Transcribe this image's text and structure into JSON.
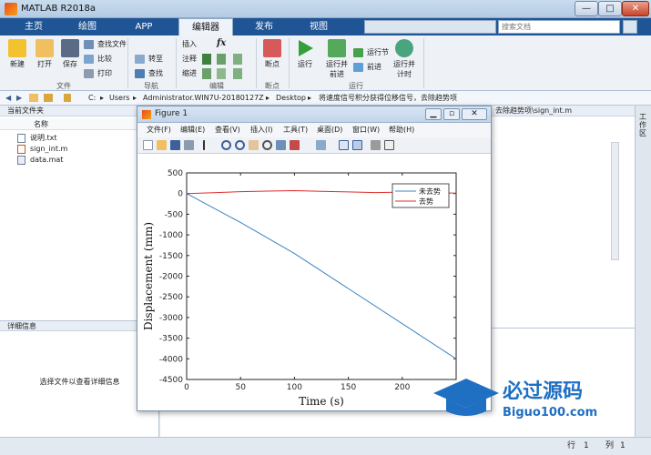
{
  "window": {
    "title": "MATLAB R2018a",
    "min": "—",
    "max": "□",
    "close": "✕"
  },
  "tabs": [
    {
      "label": "主页",
      "active": false
    },
    {
      "label": "绘图",
      "active": false
    },
    {
      "label": "APP",
      "active": false
    },
    {
      "label": "编辑器",
      "active": true
    },
    {
      "label": "发布",
      "active": false
    },
    {
      "label": "视图",
      "active": false
    }
  ],
  "search": {
    "placeholder": "搜索文档"
  },
  "ribbon": {
    "file": {
      "new": "新建",
      "open": "打开",
      "save": "保存",
      "find_files": "查找文件",
      "compare": "比较",
      "print": "打印",
      "group": "文件"
    },
    "nav": {
      "goto": "转至",
      "find": "查找",
      "group": "导航"
    },
    "edit": {
      "insert": "插入",
      "comment": "注释",
      "indent": "缩进",
      "fx": "fx",
      "group": "编辑"
    },
    "breakpoints": {
      "bp": "断点",
      "group": "断点"
    },
    "run": {
      "run": "运行",
      "run_advance": "运行并",
      "run_advance2": "前进",
      "run_section": "运行节",
      "advance": "前进",
      "run_time": "运行并",
      "run_time2": "计时",
      "group": "运行"
    }
  },
  "address": {
    "segments": [
      "C:",
      "Users",
      "Administrator.WIN7U-20180127Z",
      "Desktop",
      "将速度信号积分获得位移信号，去除趋势项"
    ]
  },
  "left_panel": {
    "title": "当前文件夹",
    "col_name": "名称",
    "files": [
      "说明.txt",
      "sign_int.m",
      "data.mat"
    ],
    "details_title": "详细信息",
    "details_text": "选择文件以查看详细信息"
  },
  "editor": {
    "tab_text": "去除趋势项\\sign_int.m"
  },
  "right_strip": {
    "label": "工作区"
  },
  "statusbar": {
    "row_label": "行",
    "row_value": "1",
    "col_label": "列",
    "col_value": "1"
  },
  "figure": {
    "title": "Figure 1",
    "menus": [
      "文件(F)",
      "编辑(E)",
      "查看(V)",
      "插入(I)",
      "工具(T)",
      "桌面(D)",
      "窗口(W)",
      "帮助(H)"
    ]
  },
  "chart_data": {
    "type": "line",
    "xlabel": "Time (s)",
    "ylabel": "Displacement (mm)",
    "xlim": [
      0,
      250
    ],
    "ylim": [
      -4500,
      500
    ],
    "xticks": [
      0,
      50,
      100,
      150,
      200
    ],
    "yticks": [
      500,
      0,
      -500,
      -1000,
      -1500,
      -2000,
      -2500,
      -3000,
      -3500,
      -4000,
      -4500
    ],
    "legend_position": "top-right",
    "series": [
      {
        "name": "未去势",
        "color": "#3a84c4",
        "x": [
          0,
          50,
          100,
          150,
          200,
          250
        ],
        "y": [
          0,
          -700,
          -1450,
          -2300,
          -3150,
          -4000
        ]
      },
      {
        "name": "去势",
        "color": "#e02b2b",
        "x": [
          0,
          25,
          50,
          75,
          100,
          125,
          150,
          175,
          200,
          225,
          250
        ],
        "y": [
          0,
          20,
          45,
          60,
          70,
          55,
          40,
          25,
          35,
          25,
          10
        ]
      }
    ]
  },
  "watermark": {
    "text1": "必过源码",
    "text2": "Biguo100.com"
  }
}
